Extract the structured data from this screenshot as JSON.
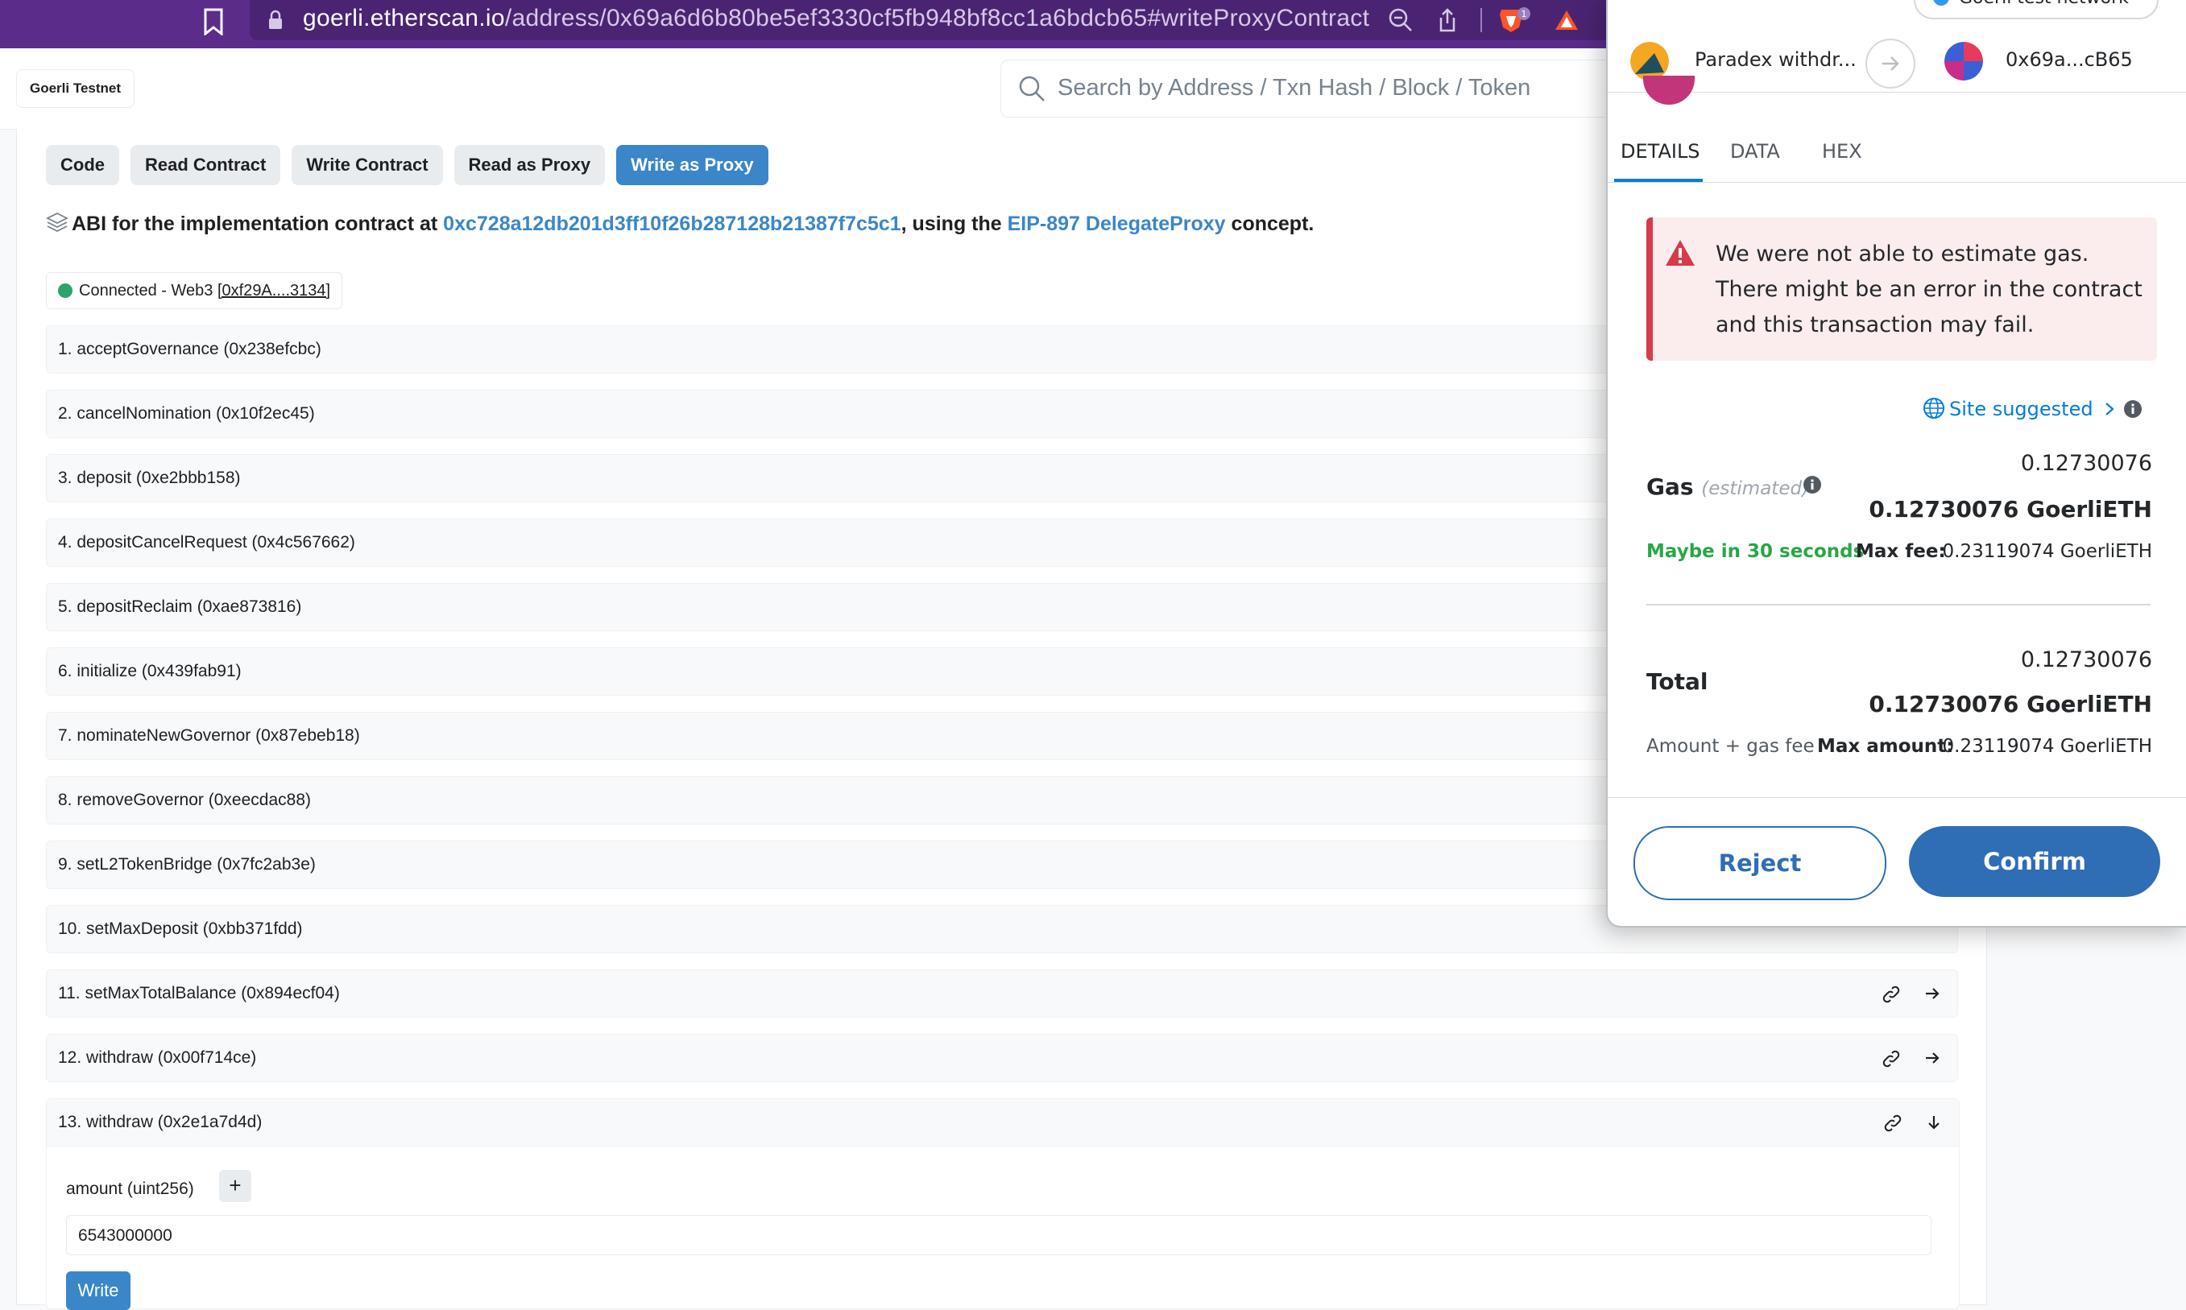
{
  "browser": {
    "url_host": "goerli.etherscan.io",
    "url_path": "/address/0x69a6d6b80be5ef3330cf5fb948bf8cc1a6bdcb65#writeProxyContract",
    "extension_badge": "1"
  },
  "header": {
    "network_badge": "Goerli Testnet",
    "search_placeholder": "Search by Address / Txn Hash / Block / Token"
  },
  "tabs": [
    {
      "label": "Code"
    },
    {
      "label": "Read Contract"
    },
    {
      "label": "Write Contract"
    },
    {
      "label": "Read as Proxy"
    },
    {
      "label": "Write as Proxy",
      "active": true
    }
  ],
  "abi": {
    "prefix": "ABI for the implementation contract at ",
    "address": "0xc728a12db201d3ff10f26b287128b21387f7c5c1",
    "middle": ", using the ",
    "link": "EIP-897 DelegateProxy",
    "suffix": " concept."
  },
  "connection": {
    "status": "Connected - Web3 ",
    "account": "[0xf29A....3134]"
  },
  "functions": [
    "1. acceptGovernance (0x238efcbc)",
    "2. cancelNomination (0x10f2ec45)",
    "3. deposit (0xe2bbb158)",
    "4. depositCancelRequest (0x4c567662)",
    "5. depositReclaim (0xae873816)",
    "6. initialize (0x439fab91)",
    "7. nominateNewGovernor (0x87ebeb18)",
    "8. removeGovernor (0xeecdac88)",
    "9. setL2TokenBridge (0x7fc2ab3e)",
    "10. setMaxDeposit (0xbb371fdd)",
    "11. setMaxTotalBalance (0x894ecf04)",
    "12. withdraw (0x00f714ce)"
  ],
  "expanded_function": {
    "label": "13. withdraw (0x2e1a7d4d)",
    "param_label": "amount (uint256)",
    "param_value": "6543000000",
    "write_label": "Write"
  },
  "metamask": {
    "network": "Goerli test network",
    "from_name": "Paradex withdr...",
    "to_name": "0x69a...cB65",
    "tabs": [
      "DETAILS",
      "DATA",
      "HEX"
    ],
    "error_text": "We were not able to estimate gas. There might be an error in the contract and this transaction may fail.",
    "site_suggested": "Site suggested",
    "gas_label": "Gas",
    "gas_sub": "(estimated)",
    "gas_fiat": "0.12730076",
    "gas_amount": "0.12730076 GoerliETH",
    "maybe_time": "Maybe in 30 seconds",
    "max_fee_label": "Max fee:",
    "max_fee_value": "0.23119074 GoerliETH",
    "total_label": "Total",
    "total_fiat": "0.12730076",
    "total_amount": "0.12730076 GoerliETH",
    "amount_gas_label": "Amount + gas fee",
    "max_amount_label": "Max amount:",
    "max_amount_value": "0.23119074 GoerliETH",
    "reject_label": "Reject",
    "confirm_label": "Confirm"
  }
}
